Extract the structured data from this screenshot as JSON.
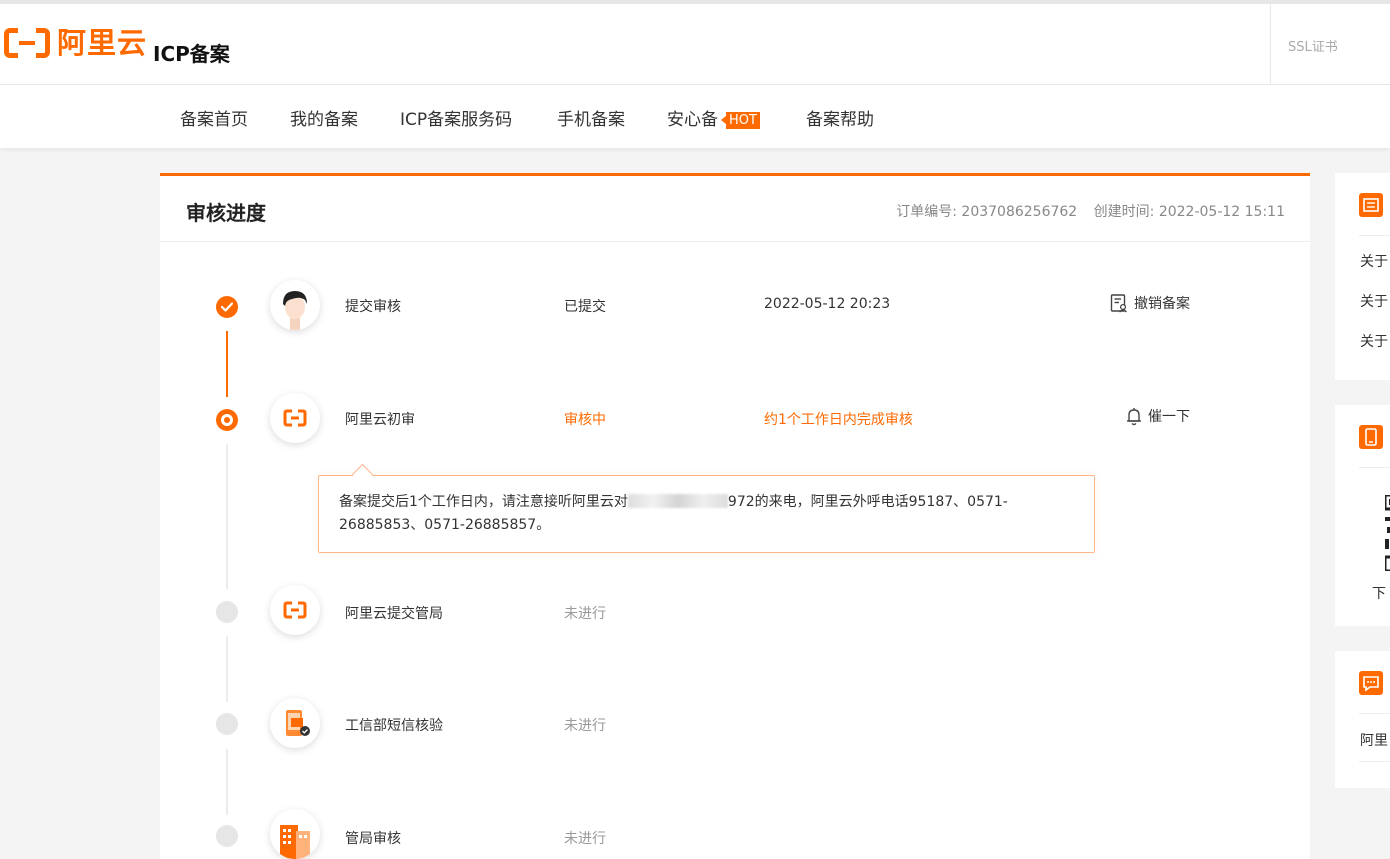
{
  "header": {
    "logo_text": "阿里云",
    "app_title": "ICP备案",
    "ssl_link": "SSL证书"
  },
  "nav": {
    "items": [
      "备案首页",
      "我的备案",
      "ICP备案服务码",
      "手机备案",
      "安心备",
      "备案帮助"
    ],
    "hot_badge": "HOT"
  },
  "progress": {
    "title": "审核进度",
    "order_no_label": "订单编号: 2037086256762",
    "created_label": "创建时间: 2022-05-12 15:11",
    "steps": [
      {
        "name": "提交审核",
        "status": "已提交",
        "time": "2022-05-12 20:23",
        "action": "撤销备案",
        "state": "done",
        "icon": "person-avatar-icon"
      },
      {
        "name": "阿里云初审",
        "status": "审核中",
        "time": "约1个工作日内完成审核",
        "action": "催一下",
        "state": "active",
        "icon": "aliyun-logo-icon"
      },
      {
        "name": "阿里云提交管局",
        "status": "未进行",
        "state": "idle",
        "icon": "aliyun-logo-icon"
      },
      {
        "name": "工信部短信核验",
        "status": "未进行",
        "state": "idle",
        "icon": "phone-verify-icon"
      },
      {
        "name": "管局审核",
        "status": "未进行",
        "state": "idle",
        "icon": "building-icon"
      }
    ],
    "tip": {
      "part1": "备案提交后1个工作日内，请注意接听阿里云对",
      "part2": "972的来电，阿里云外呼电话95187、0571-26885853、0571-26885857。"
    }
  },
  "side": {
    "notice_links": [
      "关于",
      "关于",
      "关于"
    ],
    "download_text": "下",
    "chat_text": "阿里"
  },
  "colors": {
    "accent": "#ff6a00",
    "idle": "#e6e6e6",
    "tip_border": "#ffb68a"
  }
}
